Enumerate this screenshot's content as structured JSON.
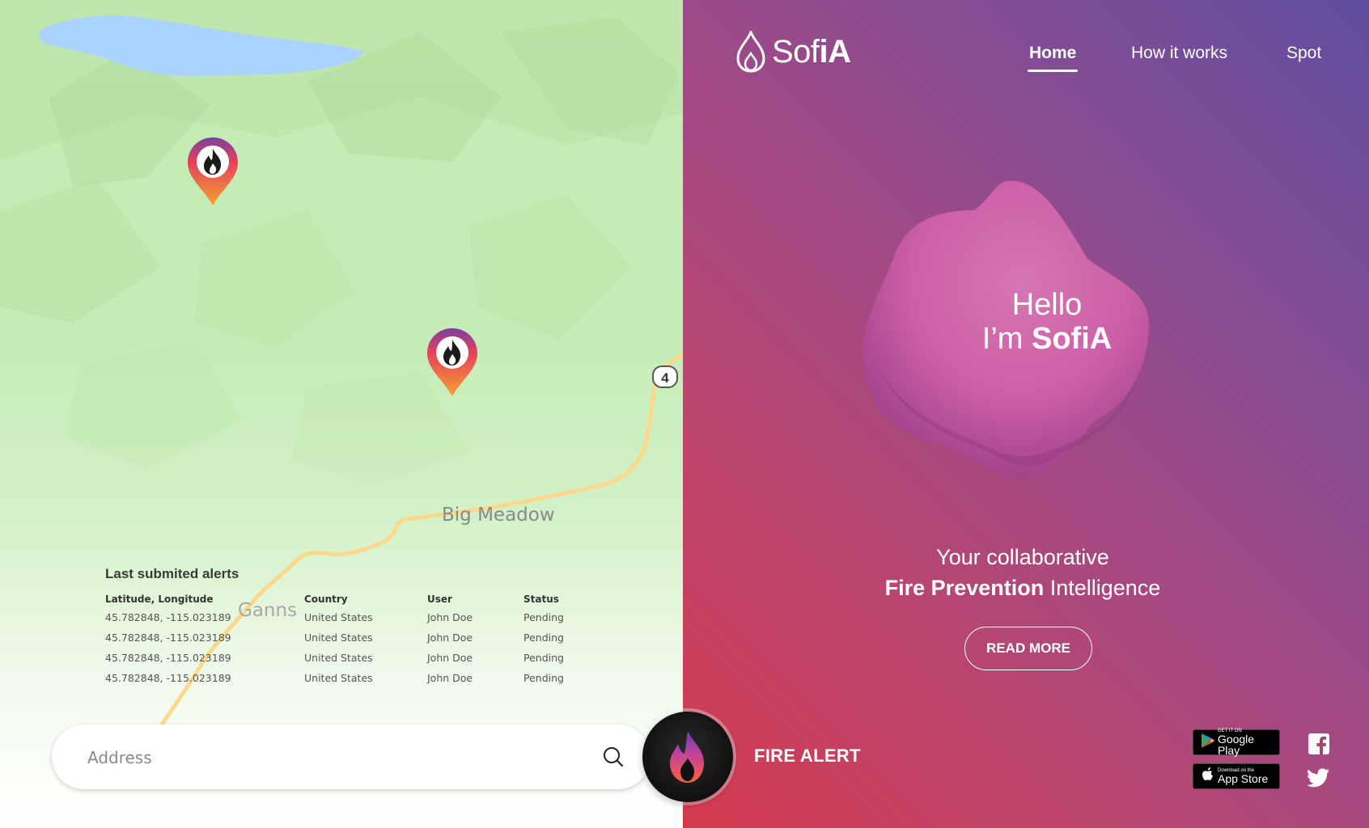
{
  "map": {
    "labels": {
      "big_meadow": "Big Meadow",
      "ganns": "Ganns",
      "route_shield": "4"
    },
    "pins": [
      {
        "icon": "fire-icon"
      },
      {
        "icon": "fire-icon"
      }
    ]
  },
  "alerts": {
    "title": "Last submited alerts",
    "columns": [
      "Latitude, Longitude",
      "Country",
      "User",
      "Status"
    ],
    "rows": [
      [
        "45.782848, -115.023189",
        "United States",
        "John Doe",
        "Pending"
      ],
      [
        "45.782848, -115.023189",
        "United States",
        "John Doe",
        "Pending"
      ],
      [
        "45.782848, -115.023189",
        "United States",
        "John Doe",
        "Pending"
      ],
      [
        "45.782848, -115.023189",
        "United States",
        "John Doe",
        "Pending"
      ]
    ]
  },
  "search": {
    "placeholder": "Address",
    "icon": "search-icon"
  },
  "logo": {
    "text_light": "Sof",
    "text_bold": "iA"
  },
  "nav": {
    "items": [
      "Home",
      "How it works",
      "Spot"
    ],
    "active": "Home"
  },
  "hero": {
    "line1": "Hello",
    "line2_prefix": "I’m ",
    "line2_bold": "SofiA",
    "tagline_line1": "Your collaborative",
    "tagline_bold": "Fire Prevention",
    "tagline_rest": " Intelligence",
    "read_more": "READ MORE"
  },
  "fire_alert": {
    "label": "FIRE ALERT",
    "icon": "flame-icon"
  },
  "stores": {
    "google": {
      "small": "GET IT ON",
      "big": "Google Play"
    },
    "apple": {
      "small": "Download on the",
      "big": "App Store"
    }
  },
  "social": [
    "facebook-icon",
    "twitter-icon"
  ],
  "colors": {
    "panel_top": "#5f4e9e",
    "panel_bottom": "#d43a4e",
    "map_green": "#c4ecb6",
    "lake": "#aad3ff",
    "road": "#fcd88d"
  }
}
